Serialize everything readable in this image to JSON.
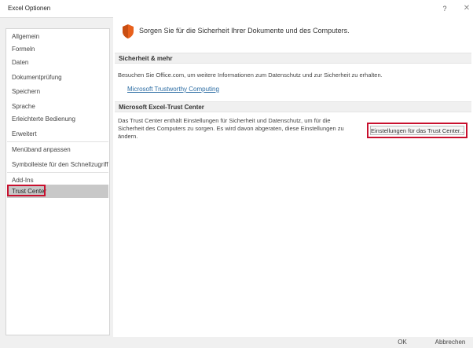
{
  "window": {
    "title": "Excel Optionen",
    "help_label": "?",
    "close_label": "✕"
  },
  "sidebar": {
    "items": [
      {
        "label": "Allgemein"
      },
      {
        "label": "Formeln"
      },
      {
        "label": "Daten"
      },
      {
        "label": "Dokumentprüfung"
      },
      {
        "label": "Speichern"
      },
      {
        "label": "Sprache"
      },
      {
        "label": "Erleichterte Bedienung"
      },
      {
        "label": "Erweitert"
      },
      {
        "label": "Menüband anpassen"
      },
      {
        "label": "Symbolleiste für den Schnellzugriff"
      },
      {
        "label": "Add-Ins"
      },
      {
        "label": "Trust Center",
        "selected": true
      }
    ]
  },
  "main": {
    "headline": "Sorgen Sie für die Sicherheit Ihrer Dokumente und des Computers.",
    "section_privacy": {
      "title": "Sicherheit & mehr",
      "text": "Besuchen Sie Office.com, um weitere Informationen zum Datenschutz und zur Sicherheit zu erhalten.",
      "link": "Microsoft Trustworthy Computing"
    },
    "section_trust": {
      "title": "Microsoft Excel-Trust Center",
      "text_line1": "Das Trust Center enthält Einstellungen für Sicherheit und Datenschutz, um für die",
      "text_line2": "Sicherheit des Computers zu sorgen. Es wird davon abgeraten, diese Einstellungen zu",
      "text_line3": "ändern.",
      "button_label": "Einstellungen für das Trust Center..."
    }
  },
  "footer": {
    "ok_label": "OK",
    "cancel_label": "Abbrechen"
  },
  "colors": {
    "highlight": "#c8102e",
    "shield": "#e8601c",
    "link": "#2b6ca3",
    "selected_bg": "#c8c8c8"
  },
  "icons": {
    "hero": "shield-icon",
    "help": "help-icon",
    "close": "close-icon"
  }
}
